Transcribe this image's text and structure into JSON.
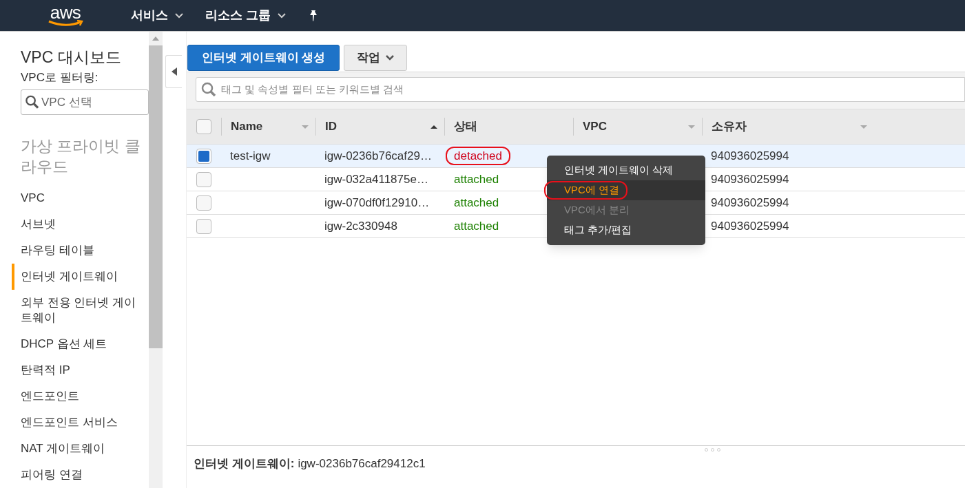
{
  "topbar": {
    "logo": "aws",
    "menus": [
      {
        "label": "서비스"
      },
      {
        "label": "리소스 그룹"
      }
    ]
  },
  "sidebar": {
    "title": "VPC 대시보드",
    "filter_label": "VPC로 필터링:",
    "filter_placeholder": "VPC 선택",
    "section": "가상 프라이빗 클라우드",
    "items": [
      {
        "label": "VPC",
        "selected": false
      },
      {
        "label": "서브넷",
        "selected": false
      },
      {
        "label": "라우팅 테이블",
        "selected": false
      },
      {
        "label": "인터넷 게이트웨이",
        "selected": true
      },
      {
        "label": "외부 전용 인터넷 게이트웨이",
        "selected": false
      },
      {
        "label": "DHCP 옵션 세트",
        "selected": false
      },
      {
        "label": "탄력적 IP",
        "selected": false
      },
      {
        "label": "엔드포인트",
        "selected": false
      },
      {
        "label": "엔드포인트 서비스",
        "selected": false
      },
      {
        "label": "NAT 게이트웨이",
        "selected": false
      },
      {
        "label": "피어링 연결",
        "selected": false
      }
    ]
  },
  "toolbar": {
    "create_button": "인터넷 게이트웨이 생성",
    "actions_button": "작업"
  },
  "search": {
    "placeholder": "태그 및 속성별 필터 또는 키워드별 검색"
  },
  "table": {
    "select_all": {
      "checked": false
    },
    "columns": [
      {
        "label": "Name",
        "sortable": true,
        "sorted": false
      },
      {
        "label": "ID",
        "sortable": true,
        "sorted": true
      },
      {
        "label": "상태",
        "sortable": false,
        "sorted": false
      },
      {
        "label": "VPC",
        "sortable": true,
        "sorted": false
      },
      {
        "label": "소유자",
        "sortable": true,
        "sorted": false
      }
    ],
    "rows": [
      {
        "selected": true,
        "name": "test-igw",
        "id": "igw-0236b76caf29…",
        "status": "detached",
        "color": "#d0021b",
        "circled": true,
        "owner": "940936025994"
      },
      {
        "selected": false,
        "id": "igw-032a411875e…",
        "status": "attached",
        "color": "#1d8102",
        "circled": false,
        "owner": "940936025994"
      },
      {
        "selected": false,
        "id": "igw-070df0f12910…",
        "status": "attached",
        "color": "#1d8102",
        "circled": false,
        "owner": "940936025994"
      },
      {
        "selected": false,
        "id": "igw-2c330948",
        "status": "attached",
        "color": "#1d8102",
        "circled": false,
        "owner": "940936025994"
      }
    ]
  },
  "context_menu": {
    "items": [
      {
        "label": "인터넷 게이트웨이 삭제",
        "disabled": false,
        "highlighted": false,
        "circled": false
      },
      {
        "label": "VPC에 연결",
        "disabled": false,
        "highlighted": true,
        "circled": true
      },
      {
        "label": "VPC에서 분리",
        "disabled": true,
        "highlighted": false,
        "circled": false
      },
      {
        "label": "태그 추가/편집",
        "disabled": false,
        "highlighted": false,
        "circled": false
      }
    ]
  },
  "details": {
    "label": "인터넷 게이트웨이:",
    "value": "igw-0236b76caf29412c1"
  }
}
